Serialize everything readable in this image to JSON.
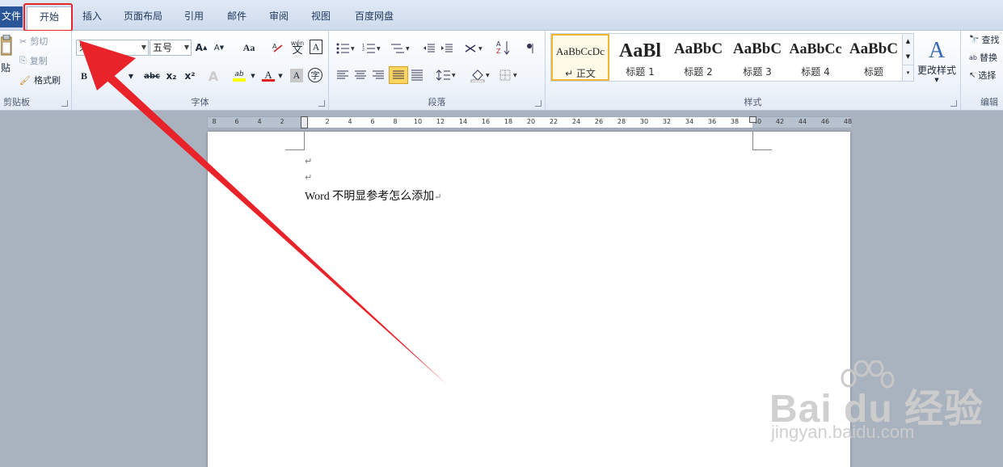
{
  "tabs": {
    "file": "文件",
    "home": "开始",
    "insert": "插入",
    "page_layout": "页面布局",
    "references": "引用",
    "mailings": "邮件",
    "review": "审阅",
    "view": "视图",
    "baidu_pan": "百度网盘"
  },
  "clipboard": {
    "paste": "贴",
    "cut": "剪切",
    "copy": "复制",
    "format_painter": "格式刷",
    "group_label": "剪贴板"
  },
  "font": {
    "font_name": "宋",
    "font_size": "五号",
    "grow": "A",
    "shrink": "A",
    "change_case": "Aa",
    "pinyin": "wén",
    "border_char": "A",
    "bold": "B",
    "italic": "I",
    "strike": "abc",
    "subscript": "x₂",
    "superscript": "x²",
    "font_color": "A",
    "shading": "A",
    "enclose": "字",
    "highlight": "ab",
    "group_label": "字体"
  },
  "paragraph": {
    "group_label": "段落"
  },
  "styles": {
    "items": [
      {
        "sample": "AaBbCcDc",
        "name": "↵ 正文",
        "size": "13px",
        "bold": false
      },
      {
        "sample": "AaBl",
        "name": "标题 1",
        "size": "24px",
        "bold": true
      },
      {
        "sample": "AaBbC",
        "name": "标题 2",
        "size": "19px",
        "bold": true
      },
      {
        "sample": "AaBbC",
        "name": "标题 3",
        "size": "19px",
        "bold": true
      },
      {
        "sample": "AaBbCc",
        "name": "标题 4",
        "size": "18px",
        "bold": true
      },
      {
        "sample": "AaBbC",
        "name": "标题",
        "size": "19px",
        "bold": true
      }
    ],
    "change_styles": "更改样式",
    "group_label": "样式"
  },
  "editing": {
    "find": "查找",
    "replace": "替换",
    "select": "选择",
    "group_label": "编辑"
  },
  "ruler": {
    "ticks": [
      "8",
      "6",
      "4",
      "2",
      "2",
      "4",
      "6",
      "8",
      "10",
      "12",
      "14",
      "16",
      "18",
      "20",
      "22",
      "24",
      "26",
      "28",
      "30",
      "32",
      "34",
      "36",
      "38",
      "40",
      "42",
      "44",
      "46",
      "48"
    ]
  },
  "document": {
    "para_mark": "↵",
    "text": "Word 不明显参考怎么添加"
  },
  "watermark": {
    "brand": "Bai du 经验",
    "url": "jingyan.baidu.com"
  },
  "colors": {
    "annotation_red": "#e8232a",
    "file_tab": "#2a5699",
    "selected_style": "#f0b634"
  }
}
